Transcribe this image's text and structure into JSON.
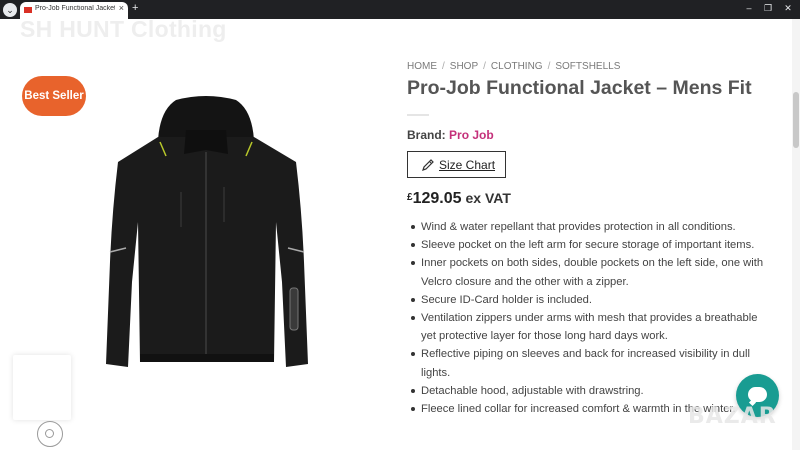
{
  "browser": {
    "tab_title": "Pro-Job Functional Jacket - Men",
    "tab_close": "×",
    "new_tab": "+",
    "minimize": "–",
    "maximize": "❐",
    "close": "✕",
    "tab_menu": "⌄"
  },
  "site": {
    "name": "SH HUNT Clothing"
  },
  "product": {
    "badge": "Best Seller",
    "breadcrumb": [
      "HOME",
      "SHOP",
      "CLOTHING",
      "SOFTSHELLS"
    ],
    "breadcrumb_sep": "/",
    "title": "Pro-Job Functional Jacket – Mens Fit",
    "brand_label": "Brand:",
    "brand_name": "Pro Job",
    "size_chart_label": "Size Chart",
    "price_currency": "£",
    "price_amount": "129.05",
    "price_suffix": "ex VAT",
    "features": [
      "Wind & water repellant that provides protection in all conditions.",
      "Sleeve pocket on the left arm for secure storage of important items.",
      "Inner pockets on both sides, double pockets on the left side, one with Velcro closure and the other with a zipper.",
      "Secure ID-Card holder is included.",
      "Ventilation zippers under arms with mesh that provides a breathable yet protective layer for those long hard days work.",
      "Reflective piping on sleeves and back for increased visibility in dull lights.",
      "Detachable hood, adjustable with drawstring.",
      "Fleece lined collar for increased comfort & warmth in the winter."
    ]
  },
  "watermark": "BAZAR",
  "colors": {
    "badge": "#e8632c",
    "brand_link": "#c4307a",
    "chat": "#199c92"
  },
  "icons": [
    "pencil-icon",
    "chat-icon",
    "zoom-icon"
  ]
}
